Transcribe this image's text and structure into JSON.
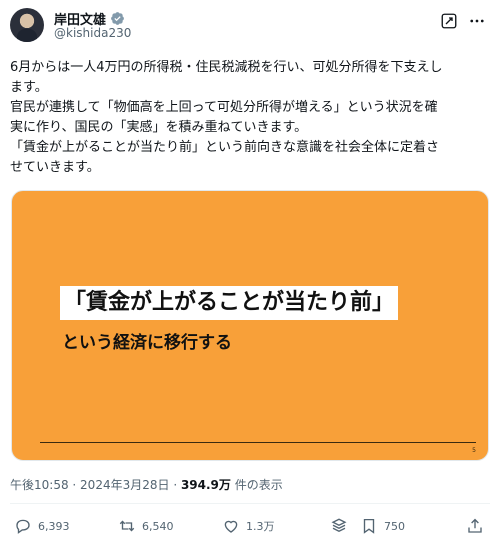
{
  "author": {
    "name": "岸田文雄",
    "handle": "@kishida230"
  },
  "icons": {
    "verified": "verified-badge-icon",
    "grok": "grok-icon",
    "more": "more-icon",
    "reply": "reply-icon",
    "retweet": "retweet-icon",
    "like": "heart-icon",
    "views": "views-icon",
    "bookmark": "bookmark-icon",
    "share": "share-icon"
  },
  "colors": {
    "accent_blue": "#1d9bf0",
    "media_background": "#f8a039",
    "muted_text": "#536471"
  },
  "tweet": {
    "lines": [
      "6月からは一人4万円の所得税・住民税減税を行い、可処分所得を下支えし",
      "ます。",
      "官民が連携して「物価高を上回って可処分所得が増える」という状況を確",
      "実に作り、国民の「実感」を積み重ねていきます。",
      "「賃金が上がることが当たり前」という前向きな意識を社会全体に定着さ",
      "せていきます。"
    ]
  },
  "media": {
    "headline": "「賃金が上がることが当たり前」",
    "subline": "という経済に移行する",
    "page_number": "5"
  },
  "meta": {
    "time": "午後10:58",
    "separator": " · ",
    "date": "2024年3月28日",
    "views_count": "394.9万",
    "views_label": " 件の表示"
  },
  "actions": {
    "reply_count": "6,393",
    "retweet_count": "6,540",
    "like_count": "1.3万",
    "bookmark_count": "750"
  }
}
